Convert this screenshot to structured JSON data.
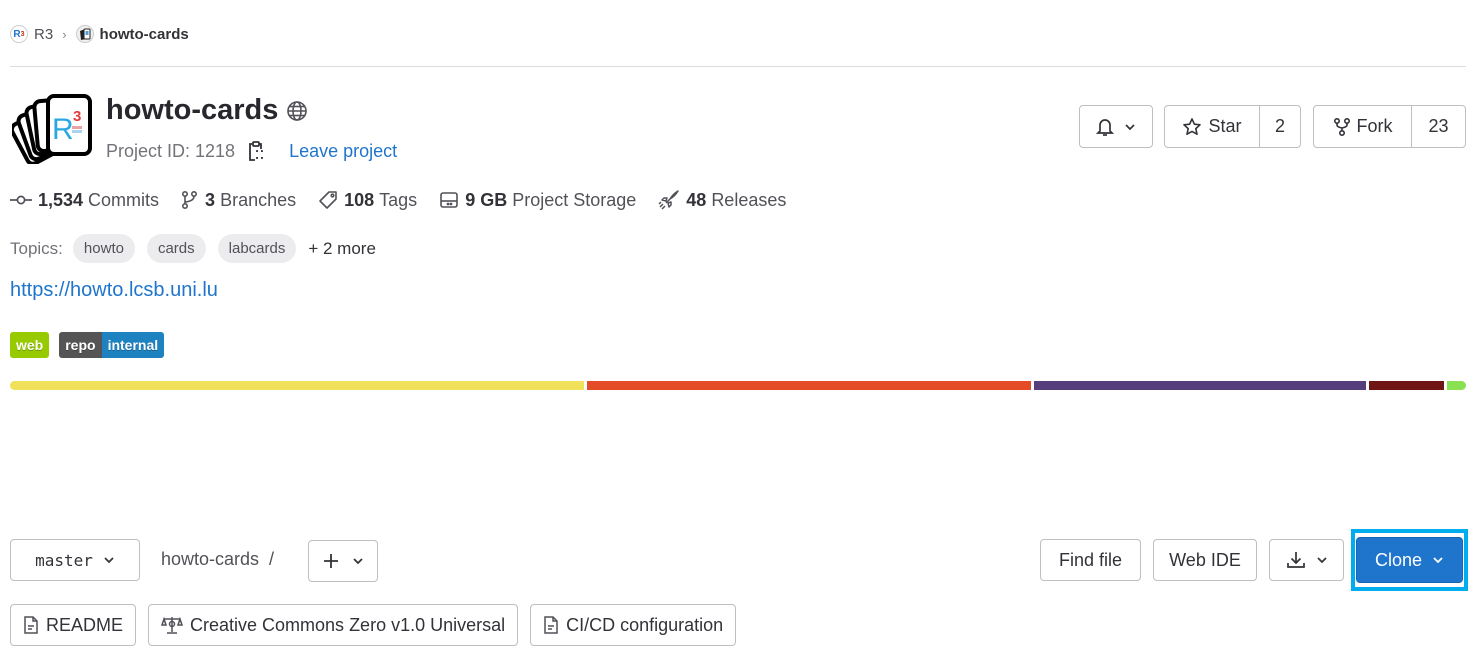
{
  "breadcrumb": {
    "group_avatar_text": "R",
    "group_avatar_sup": "3",
    "group": "R3",
    "separator": "›",
    "project": "howto-cards"
  },
  "project": {
    "title": "howto-cards",
    "visibility_icon": "globe-icon",
    "id_text": "Project ID: 1218",
    "leave_label": "Leave project"
  },
  "actions": {
    "notification_icon": "bell-icon",
    "star_label": "Star",
    "star_count": "2",
    "fork_label": "Fork",
    "fork_count": "23"
  },
  "stats": [
    {
      "icon": "commit-icon",
      "value": "1,534",
      "label": "Commits"
    },
    {
      "icon": "branch-icon",
      "value": "3",
      "label": "Branches"
    },
    {
      "icon": "tag-icon",
      "value": "108",
      "label": "Tags"
    },
    {
      "icon": "storage-icon",
      "value": "9 GB",
      "label": "Project Storage"
    },
    {
      "icon": "rocket-icon",
      "value": "48",
      "label": "Releases"
    }
  ],
  "topics": {
    "label": "Topics:",
    "items": [
      "howto",
      "cards",
      "labcards"
    ],
    "more": "+ 2 more"
  },
  "website_url": "https://howto.lcsb.uni.lu",
  "badges": [
    {
      "parts": [
        {
          "text": "web",
          "color": "#97ca00"
        }
      ]
    },
    {
      "parts": [
        {
          "text": "repo",
          "color": "#555555"
        },
        {
          "text": "internal",
          "color": "#1f82c0"
        }
      ]
    }
  ],
  "languages": [
    {
      "color": "#f1e05a",
      "share": 39.5
    },
    {
      "color": "#e34c26",
      "share": 30.6
    },
    {
      "color": "#563d7c",
      "share": 22.8
    },
    {
      "color": "#701516",
      "share": 5.2
    },
    {
      "color": "#89e051",
      "share": 1.3
    }
  ],
  "repo_toolbar": {
    "branch": "master",
    "path": "howto-cards",
    "path_separator": "/",
    "add_symbol": "+",
    "find_file": "Find file",
    "web_ide": "Web IDE",
    "clone": "Clone"
  },
  "quick_links": [
    {
      "icon": "file-icon",
      "label": "README"
    },
    {
      "icon": "scale-icon",
      "label": "Creative Commons Zero v1.0 Universal"
    },
    {
      "icon": "file-icon",
      "label": "CI/CD configuration"
    }
  ],
  "colors": {
    "link": "#1f75cb",
    "primary_button": "#1f75cb",
    "highlight": "#00aeef"
  }
}
